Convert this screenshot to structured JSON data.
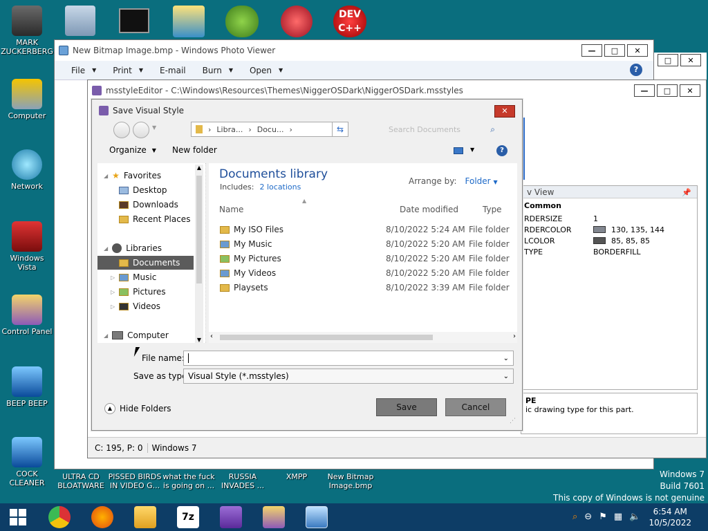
{
  "desktop": {
    "left_icons": [
      {
        "label": "MARK ZUCKERBERG"
      },
      {
        "label": "Computer"
      },
      {
        "label": "Network"
      },
      {
        "label": "Windows Vista"
      },
      {
        "label": "Control Panel"
      },
      {
        "label": "BEEP BEEP"
      },
      {
        "label": "COCK CLEANER"
      }
    ],
    "bottom_icons": [
      {
        "label": "ULTRA CD BLOATWARE"
      },
      {
        "label": "PISSED BIRDS IN VIDEO G..."
      },
      {
        "label": "what the fuck is going on ..."
      },
      {
        "label": "RUSSIA INVADES ..."
      },
      {
        "label": "XMPP"
      },
      {
        "label": "New Bitmap Image.bmp"
      }
    ],
    "watermark": {
      "line1": "Windows 7",
      "line2": "Build 7601",
      "line3": "This copy of Windows is not genuine"
    }
  },
  "photo_viewer": {
    "title": "New Bitmap Image.bmp - Windows Photo Viewer",
    "menu": [
      "File",
      "Print",
      "E-mail",
      "Burn",
      "Open"
    ]
  },
  "editor": {
    "title": "msstyleEditor - C:\\Windows\\Resources\\Themes\\NiggerOSDark\\NiggerOSDark.msstyles",
    "status_left": "C: 195, P: 0",
    "status_right": "Windows 7",
    "property_panel_title": "v View",
    "property_group": "Common",
    "properties": [
      {
        "name": "RDERSIZE",
        "value": "1",
        "swatch": null
      },
      {
        "name": "RDERCOLOR",
        "value": "130, 135, 144",
        "swatch": "#828790"
      },
      {
        "name": "LCOLOR",
        "value": "85, 85, 85",
        "swatch": "#555555"
      },
      {
        "name": "TYPE",
        "value": "BORDERFILL",
        "swatch": null
      }
    ],
    "desc_title": "PE",
    "desc_text": "ic drawing type for this part."
  },
  "dialog": {
    "title": "Save Visual Style",
    "breadcrumb": [
      "Libra...",
      "Docu..."
    ],
    "search_placeholder": "Search Documents",
    "organize": "Organize",
    "new_folder": "New folder",
    "tree": {
      "favorites": "Favorites",
      "fav_items": [
        "Desktop",
        "Downloads",
        "Recent Places"
      ],
      "libraries": "Libraries",
      "lib_items": [
        "Documents",
        "Music",
        "Pictures",
        "Videos"
      ],
      "computer": "Computer"
    },
    "library_title": "Documents library",
    "includes_label": "Includes:",
    "includes_link": "2 locations",
    "arrange_label": "Arrange by:",
    "arrange_value": "Folder",
    "columns": {
      "name": "Name",
      "date": "Date modified",
      "type": "Type"
    },
    "files": [
      {
        "name": "My ISO Files",
        "date": "8/10/2022 5:24 AM",
        "type": "File folder"
      },
      {
        "name": "My Music",
        "date": "8/10/2022 5:20 AM",
        "type": "File folder"
      },
      {
        "name": "My Pictures",
        "date": "8/10/2022 5:20 AM",
        "type": "File folder"
      },
      {
        "name": "My Videos",
        "date": "8/10/2022 5:20 AM",
        "type": "File folder"
      },
      {
        "name": "Playsets",
        "date": "8/10/2022 3:39 AM",
        "type": "File folder"
      }
    ],
    "file_name_label": "File name:",
    "file_name_value": "",
    "save_type_label": "Save as type:",
    "save_type_value": "Visual Style (*.msstyles)",
    "hide_folders": "Hide Folders",
    "save": "Save",
    "cancel": "Cancel"
  },
  "taskbar": {
    "time": "6:54 AM",
    "date": "10/5/2022"
  }
}
